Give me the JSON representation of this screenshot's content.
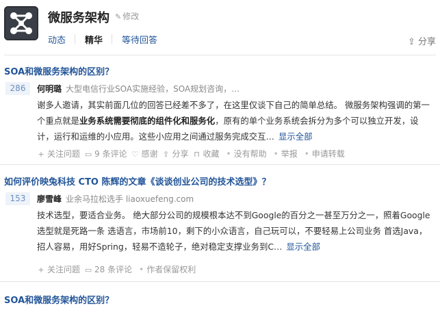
{
  "header": {
    "title": "微服务架构",
    "edit_label": "修改",
    "tabs": [
      "动态",
      "精华",
      "等待回答"
    ],
    "share_label": "分享"
  },
  "questions": [
    {
      "title": "SOA和微服务架构的区别？",
      "votes": "286",
      "author": "何明璐",
      "bio": "大型电信行业SOA实施经验，SOA规划咨询，…",
      "content_pre": "谢多人邀请，其实前面几位的回答已经差不多了，在这里仅谈下自己的简单总结。 微服务架构强调的第一个重点就是",
      "content_bold": "业务系统需要彻底的组件化和服务化",
      "content_post": "，原有的单个业务系统会拆分为多个可以独立开发，设计，运行和运维的小应用。这些小应用之间通过服务完成交互…",
      "show_all": "显示全部",
      "meta": [
        "关注问题",
        "9 条评论",
        "感谢",
        "分享",
        "收藏",
        "没有帮助",
        "举报",
        "申请转载"
      ]
    },
    {
      "title": "如何评价映兔科技 CTO 陈辉的文章《谈谈创业公司的技术选型》？",
      "votes": "153",
      "author": "廖雪峰",
      "bio": "业余马拉松选手 liaoxuefeng.com",
      "content_pre": "技术选型，要适合业务。 绝大部分公司的规模根本达不到Google的百分之一甚至万分之一，照着Google选型就是死路一条 选语言，市场前10，剩下的小众语言，自己玩可以，不要轻易上公司业务 首选Java，招人容易，用好Spring，轻易不造轮子，绝对稳定支撑业务到C…",
      "content_bold": "",
      "content_post": "",
      "show_all": "显示全部",
      "meta": [
        "关注问题",
        "28 条评论",
        "作者保留权利"
      ]
    },
    {
      "title": "SOA和微服务架构的区别？"
    }
  ]
}
